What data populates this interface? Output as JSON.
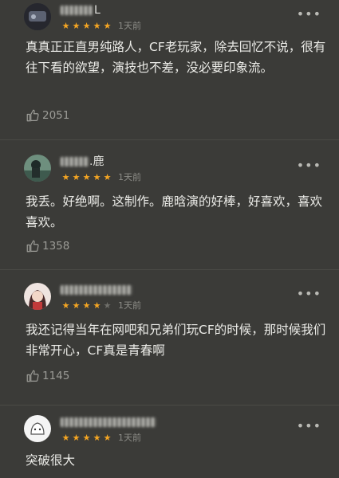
{
  "comments": [
    {
      "username": "L",
      "stars": 5,
      "time": "1天前",
      "text": "真真正正直男纯路人，CF老玩家，除去回忆不说，很有往下看的欲望，演技也不差，没必要印象流。",
      "likes": "2051",
      "avatar_color": "#2d2f3a"
    },
    {
      "username": ".鹿",
      "stars": 5,
      "time": "1天前",
      "text": "我丢。好绝啊。这制作。鹿晗演的好棒，好喜欢，喜欢喜欢。",
      "likes": "1358",
      "avatar_color": "#3d6a7a"
    },
    {
      "username": "",
      "stars": 4,
      "time": "1天前",
      "text": "我还记得当年在网吧和兄弟们玩CF的时候，那时候我们非常开心，CF真是青春啊",
      "likes": "1145",
      "avatar_color": "#e8dad5"
    },
    {
      "username": "",
      "stars": 5,
      "time": "1天前",
      "text": "突破很大",
      "likes": "",
      "avatar_color": "#f2f2f2"
    }
  ],
  "icons": {
    "more": "more-dots-icon",
    "like": "thumbs-up-icon",
    "star": "star-icon"
  },
  "colors": {
    "background": "#3b3b38",
    "star_on": "#f5a623",
    "star_off": "#6f6f6a"
  }
}
